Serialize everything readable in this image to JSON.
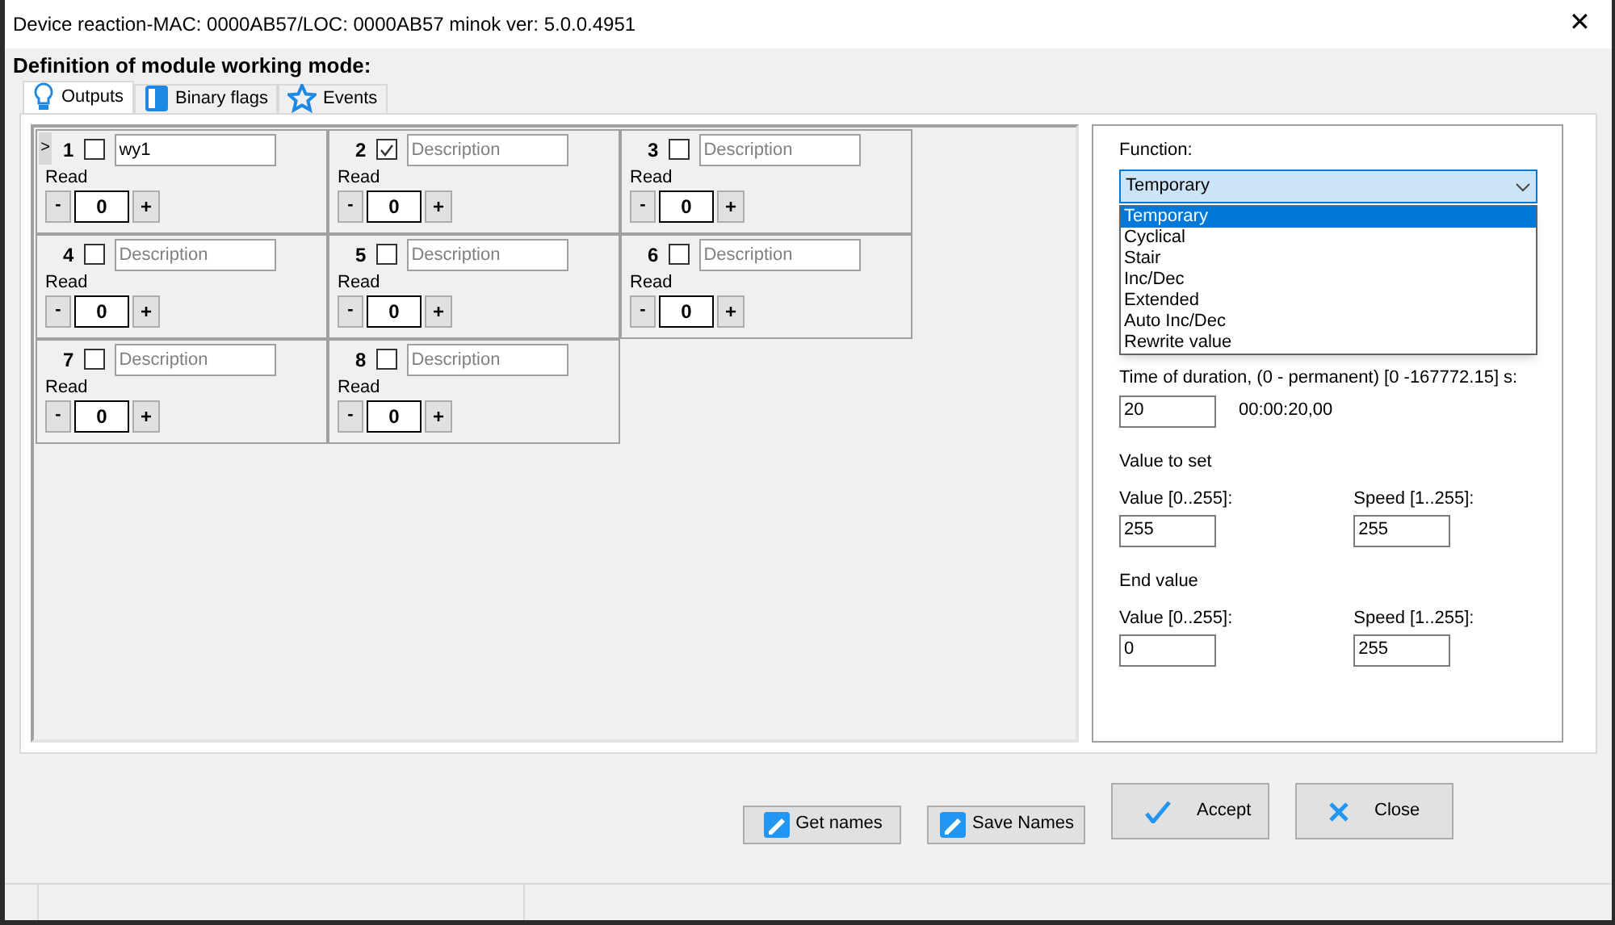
{
  "window": {
    "title": "Device reaction-MAC: 0000AB57/LOC: 0000AB57 minok ver: 5.0.0.4951",
    "close": "✕"
  },
  "heading": "Definition of module working mode:",
  "tabs": [
    {
      "label": "Outputs",
      "selected": true,
      "kind": "bulb"
    },
    {
      "label": "Binary flags",
      "selected": false,
      "kind": "flag"
    },
    {
      "label": "Events",
      "selected": false,
      "kind": "star"
    }
  ],
  "outputs": [
    {
      "number": "1",
      "checked": false,
      "value_text": "wy1",
      "pointer": ">",
      "read": "Read",
      "minus": "-",
      "value": "0",
      "plus": "+"
    },
    {
      "number": "2",
      "checked": true,
      "placeholder": "Description",
      "read": "Read",
      "minus": "-",
      "value": "0",
      "plus": "+"
    },
    {
      "number": "3",
      "checked": false,
      "placeholder": "Description",
      "read": "Read",
      "minus": "-",
      "value": "0",
      "plus": "+"
    },
    {
      "number": "4",
      "checked": false,
      "placeholder": "Description",
      "read": "Read",
      "minus": "-",
      "value": "0",
      "plus": "+"
    },
    {
      "number": "5",
      "checked": false,
      "placeholder": "Description",
      "read": "Read",
      "minus": "-",
      "value": "0",
      "plus": "+"
    },
    {
      "number": "6",
      "checked": false,
      "placeholder": "Description",
      "read": "Read",
      "minus": "-",
      "value": "0",
      "plus": "+"
    },
    {
      "number": "7",
      "checked": false,
      "placeholder": "Description",
      "read": "Read",
      "minus": "-",
      "value": "0",
      "plus": "+"
    },
    {
      "number": "8",
      "checked": false,
      "placeholder": "Description",
      "read": "Read",
      "minus": "-",
      "value": "0",
      "plus": "+"
    }
  ],
  "function": {
    "label": "Function:",
    "value": "Temporary",
    "options": [
      {
        "label": "Temporary",
        "selected": true
      },
      {
        "label": "Cyclical",
        "selected": false
      },
      {
        "label": "Stair",
        "selected": false
      },
      {
        "label": "Inc/Dec",
        "selected": false
      },
      {
        "label": "Extended",
        "selected": false
      },
      {
        "label": "Auto Inc/Dec",
        "selected": false
      },
      {
        "label": "Rewrite value",
        "selected": false
      }
    ]
  },
  "duration": {
    "label": "Time of duration, (0 - permanent) [0 -167772.15] s:",
    "value": "20",
    "formatted": "00:00:20,00"
  },
  "value_groups": [
    {
      "title": "Value to set",
      "value_label": "Value [0..255]:",
      "value": "255",
      "speed_label": "Speed [1..255]:",
      "speed": "255"
    },
    {
      "title": "End value",
      "value_label": "Value [0..255]:",
      "value": "0",
      "speed_label": "Speed [1..255]:",
      "speed": "255"
    }
  ],
  "buttons": [
    {
      "label": "Get names",
      "kind": "get"
    },
    {
      "label": "Save Names",
      "kind": "save"
    },
    {
      "label": "Accept",
      "kind": "accept"
    },
    {
      "label": "Close",
      "kind": "close"
    }
  ]
}
